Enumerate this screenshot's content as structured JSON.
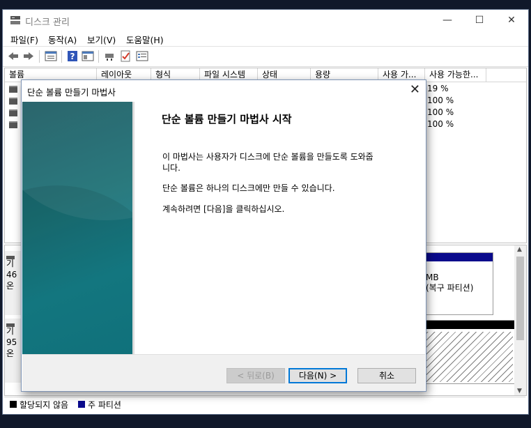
{
  "window": {
    "title": "디스크 관리",
    "controls": {
      "minimize": "—",
      "maximize": "☐",
      "close": "✕"
    }
  },
  "menu": [
    "파일(F)",
    "동작(A)",
    "보기(V)",
    "도움말(H)"
  ],
  "toolbar_icons": [
    "back-arrow-icon",
    "forward-arrow-icon",
    "properties-icon",
    "help-icon",
    "view-icon",
    "connect-icon",
    "check-icon",
    "list-icon"
  ],
  "volume_list": {
    "columns": [
      "볼륨",
      "레이아웃",
      "형식",
      "파일 시스템",
      "상태",
      "용량",
      "사용 가...",
      "사용 가능한..."
    ],
    "rows": [
      {
        "percent_free": "19 %"
      },
      {
        "percent_free": "100 %"
      },
      {
        "percent_free": "100 %"
      },
      {
        "percent_free": "100 %"
      }
    ]
  },
  "disks": [
    {
      "label_lines": [
        "기",
        "46",
        "온"
      ]
    },
    {
      "label_lines": [
        "기",
        "95",
        "온"
      ]
    }
  ],
  "partitions": {
    "recovery": {
      "size_fragment": "MB",
      "desc": "(복구 파티션)"
    }
  },
  "legend": {
    "items": [
      {
        "label": "할당되지 않음",
        "color": "#000000"
      },
      {
        "label": "주 파티션",
        "color": "#0a0a8c"
      }
    ]
  },
  "wizard": {
    "title": "단순 볼륨 만들기 마법사",
    "heading": "단순 볼륨 만들기 마법사 시작",
    "para1_line1": "이 마법사는 사용자가 디스크에 단순 볼륨을 만들도록 도와줍",
    "para1_line2": "니다.",
    "para2": "단순 볼륨은 하나의 디스크에만 만들 수 있습니다.",
    "para3": "계속하려면 [다음]을 클릭하십시오.",
    "buttons": {
      "back": "< 뒤로(B)",
      "next": "다음(N) >",
      "cancel": "취소"
    },
    "close": "✕"
  }
}
